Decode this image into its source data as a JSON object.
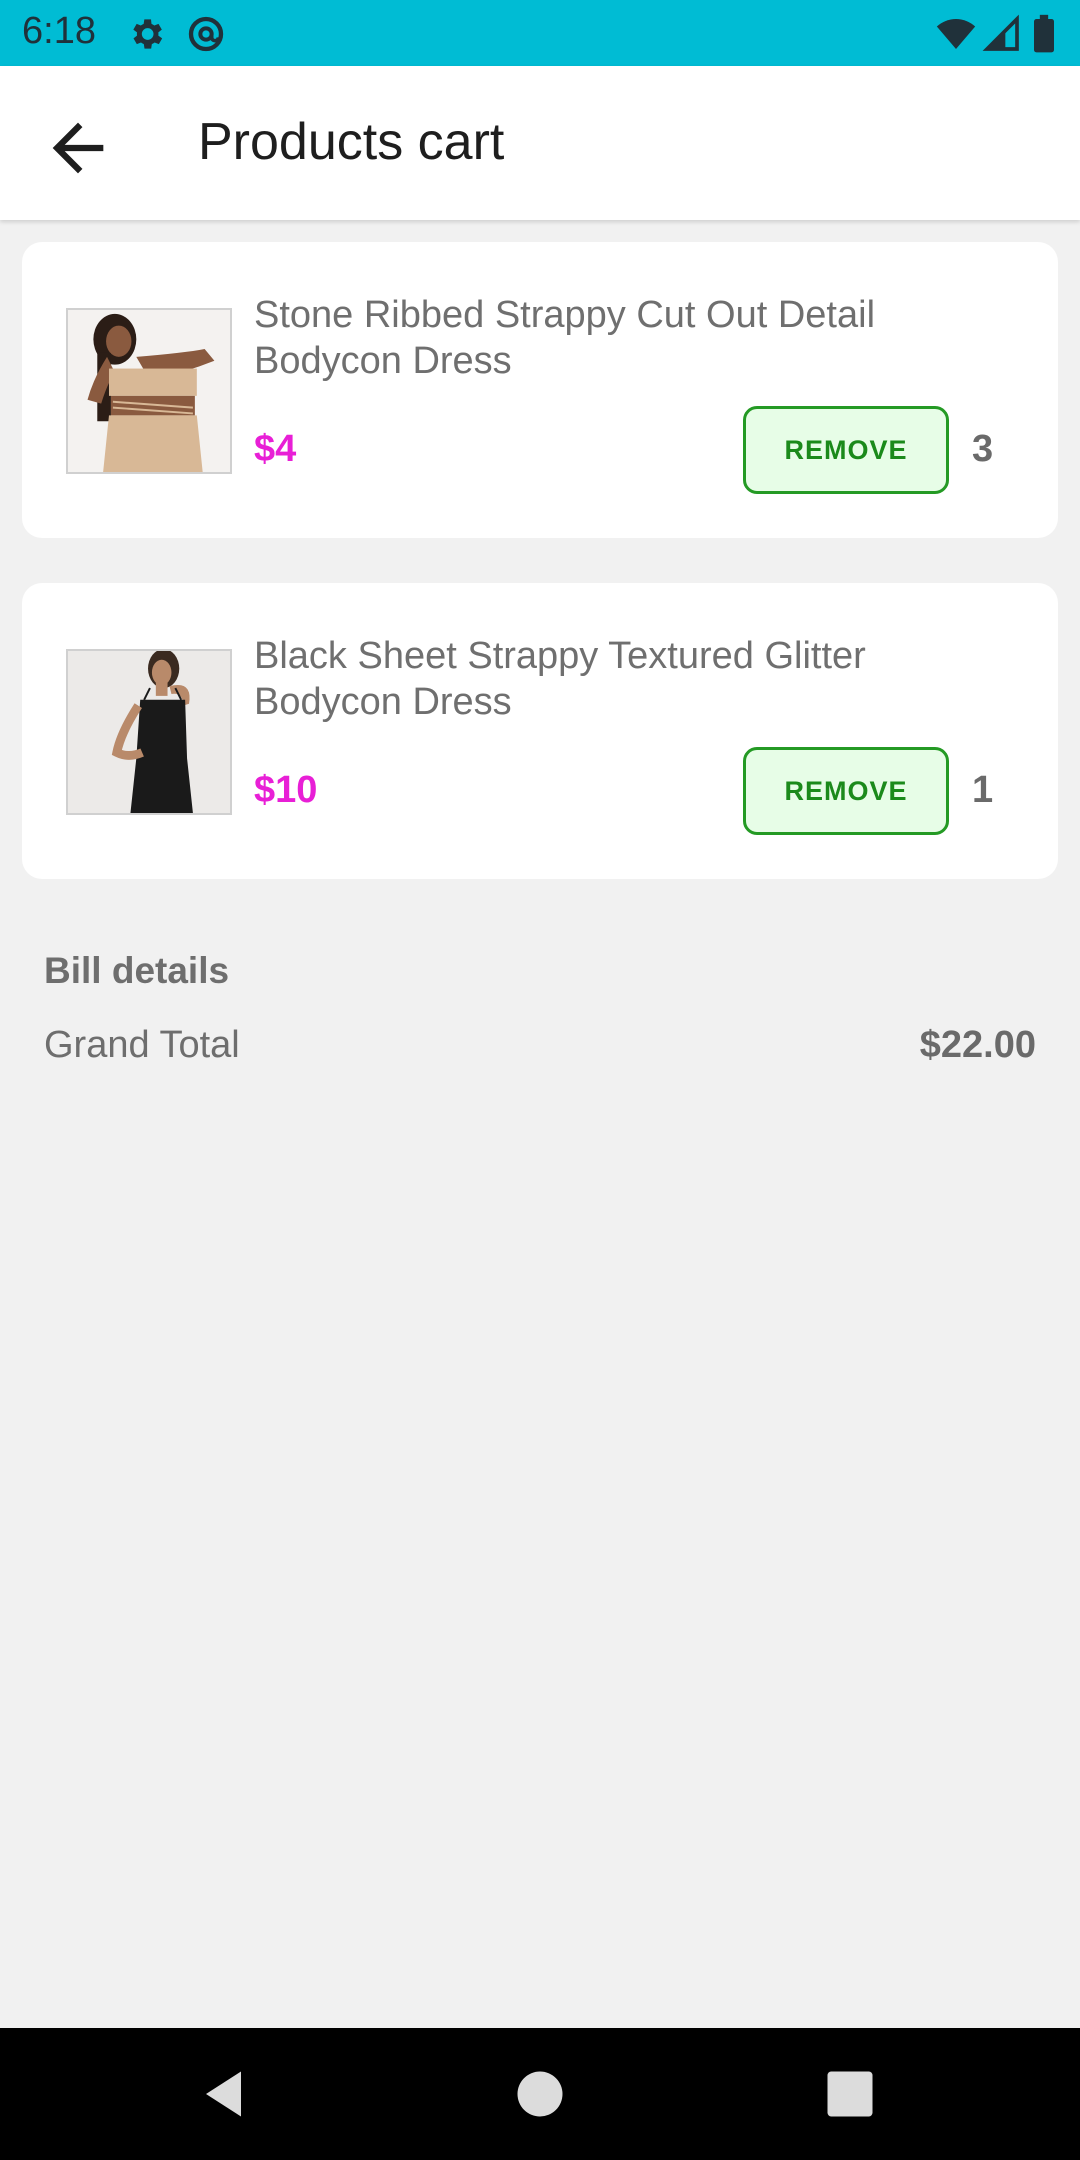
{
  "status_bar": {
    "time": "6:18",
    "icons": [
      "gear-icon",
      "at-sign-icon",
      "wifi-icon",
      "signal-icon",
      "battery-icon"
    ],
    "background": "#00bcd4"
  },
  "app_bar": {
    "title": "Products cart",
    "back_icon": "arrow-left-icon"
  },
  "cart": {
    "items": [
      {
        "name": "Stone Ribbed Strappy Cut Out Detail Bodycon Dress",
        "price": "$4",
        "remove_label": "REMOVE",
        "quantity": "3",
        "image": "beige-dress-photo"
      },
      {
        "name": "Black Sheet Strappy Textured Glitter Bodycon Dress",
        "price": "$10",
        "remove_label": "REMOVE",
        "quantity": "1",
        "image": "black-dress-photo"
      }
    ]
  },
  "bill": {
    "heading": "Bill details",
    "grand_total_label": "Grand Total",
    "grand_total_value": "$22.00"
  },
  "colors": {
    "accent_price": "#e81fd6",
    "remove_border": "#249a24",
    "remove_fill": "#e7fde7",
    "status_bar": "#00bcd4"
  },
  "nav_bar": {
    "icons": [
      "back-triangle-icon",
      "home-circle-icon",
      "recents-square-icon"
    ]
  }
}
